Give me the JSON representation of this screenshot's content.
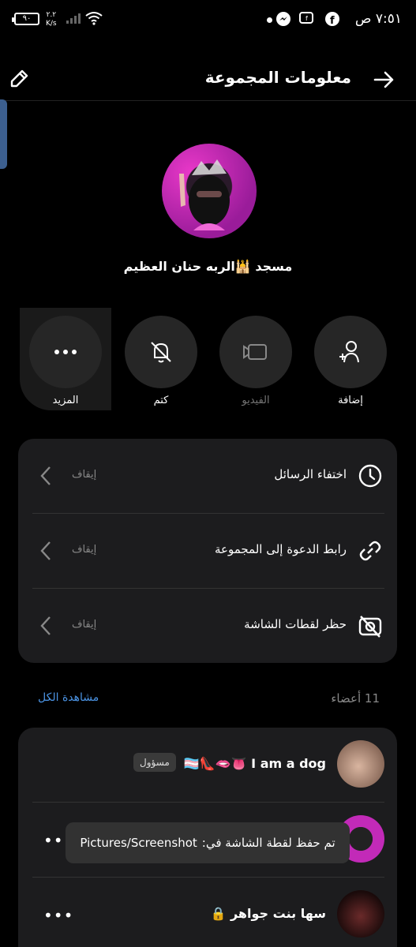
{
  "statusbar": {
    "time": "٧:٥١ ص",
    "battery": "٩٠",
    "speed_top": "٢.٢",
    "speed_bottom": "K/s"
  },
  "header": {
    "title": "معلومات المجموعة"
  },
  "group": {
    "name": "مسجد 🕌الربه حنان العظيم"
  },
  "actions": [
    {
      "label": "إضافة",
      "icon": "add-person-icon",
      "enabled": true
    },
    {
      "label": "الفيديو",
      "icon": "video-icon",
      "enabled": false
    },
    {
      "label": "كتم",
      "icon": "bell-off-icon",
      "enabled": true
    },
    {
      "label": "المزيد",
      "icon": "more-dots-icon",
      "enabled": true
    }
  ],
  "settings": [
    {
      "label": "اختفاء الرسائل",
      "value": "إيقاف",
      "icon": "clock-icon"
    },
    {
      "label": "رابط الدعوة إلى المجموعة",
      "value": "إيقاف",
      "icon": "link-icon"
    },
    {
      "label": "حظر لقطات الشاشة",
      "value": "إيقاف",
      "icon": "screenshot-block-icon"
    }
  ],
  "members": {
    "count_label": "11 أعضاء",
    "see_all": "مشاهدة الكل",
    "list": [
      {
        "name": "I am a dog 👅🫦👠🏳️‍⚧️",
        "badge": "مسؤول"
      },
      {
        "name": "",
        "badge": ""
      },
      {
        "name": "سها بنت جواهر 🔒",
        "badge": ""
      }
    ]
  },
  "toast": {
    "text": "تم حفظ لقطة الشاشة في:",
    "path": "Pictures/Screenshot"
  },
  "colors": {
    "accent": "#4c95e6",
    "card": "#1c1c1e",
    "background": "#000000"
  }
}
